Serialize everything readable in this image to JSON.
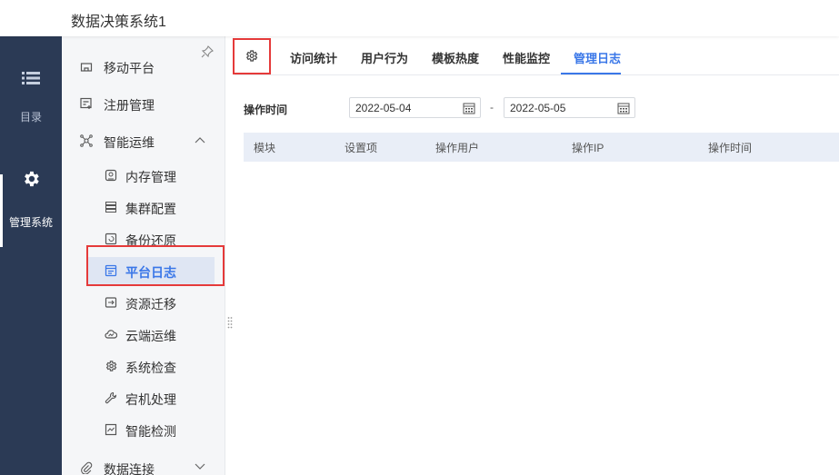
{
  "app": {
    "title": "数据决策系统1"
  },
  "left_nav": {
    "items": [
      {
        "label": "目录",
        "icon": "list-icon"
      },
      {
        "label": "管理系统",
        "icon": "gear-icon",
        "active": true
      }
    ]
  },
  "sidebar": {
    "items": [
      {
        "label": "移动平台",
        "icon": "mobile-icon"
      },
      {
        "label": "注册管理",
        "icon": "register-icon"
      },
      {
        "label": "智能运维",
        "icon": "ops-icon",
        "expanded": true
      },
      {
        "label": "内存管理",
        "icon": "memory-icon"
      },
      {
        "label": "集群配置",
        "icon": "cluster-icon"
      },
      {
        "label": "备份还原",
        "icon": "backup-icon"
      },
      {
        "label": "平台日志",
        "icon": "log-icon",
        "active": true
      },
      {
        "label": "资源迁移",
        "icon": "migrate-icon"
      },
      {
        "label": "云端运维",
        "icon": "cloud-icon"
      },
      {
        "label": "系统检查",
        "icon": "check-icon"
      },
      {
        "label": "宕机处理",
        "icon": "wrench-icon"
      },
      {
        "label": "智能检测",
        "icon": "monitor-icon"
      },
      {
        "label": "数据连接",
        "icon": "link-icon",
        "expanded": false
      }
    ]
  },
  "tabs": [
    {
      "label": "访问统计"
    },
    {
      "label": "用户行为"
    },
    {
      "label": "模板热度"
    },
    {
      "label": "性能监控"
    },
    {
      "label": "管理日志",
      "active": true
    }
  ],
  "filter": {
    "label": "操作时间",
    "start_date": "2022-05-04",
    "separator": "-",
    "end_date": "2022-05-05"
  },
  "table": {
    "columns": [
      "模块",
      "设置项",
      "操作用户",
      "操作IP",
      "操作时间"
    ]
  },
  "colors": {
    "accent": "#3a77e8",
    "left_nav_bg": "#2b3a55",
    "highlight": "#e53a3a",
    "table_header_bg": "#e9eef7"
  }
}
